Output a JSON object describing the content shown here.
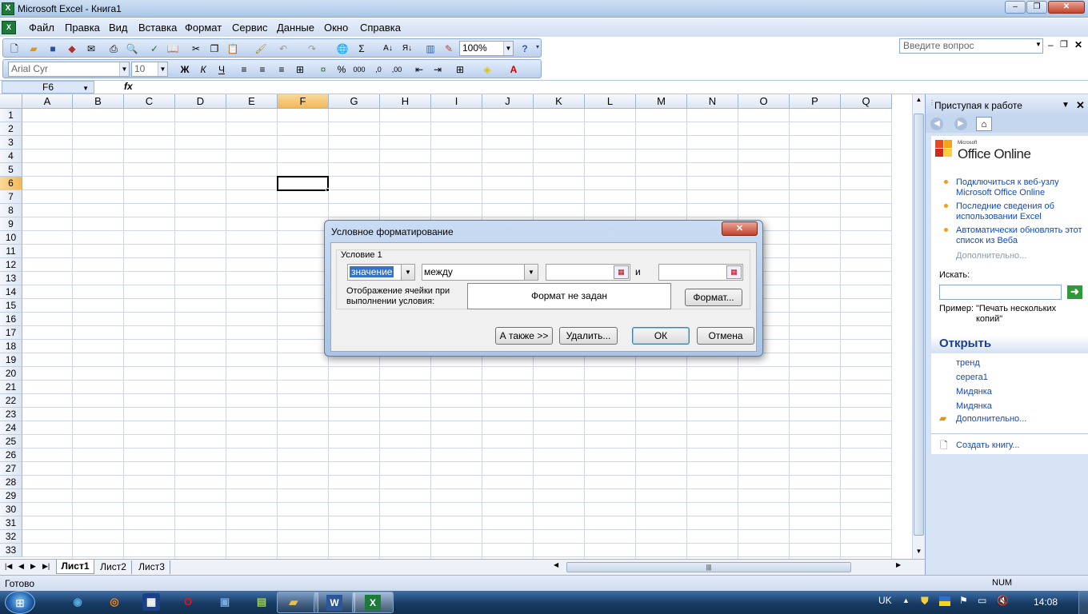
{
  "window": {
    "title": "Microsoft Excel - Книга1"
  },
  "menu": {
    "items": [
      "Файл",
      "Правка",
      "Вид",
      "Вставка",
      "Формат",
      "Сервис",
      "Данные",
      "Окно",
      "Справка"
    ],
    "ask_placeholder": "Введите вопрос"
  },
  "toolbar": {
    "zoom": "100%",
    "font_name": "Arial Cyr",
    "font_size": "10"
  },
  "formula": {
    "cell_ref": "F6",
    "fx": "fx"
  },
  "sheet": {
    "columns": [
      "A",
      "B",
      "C",
      "D",
      "E",
      "F",
      "G",
      "H",
      "I",
      "J",
      "K",
      "L",
      "M",
      "N",
      "O",
      "P",
      "Q"
    ],
    "rows": [
      "1",
      "2",
      "3",
      "4",
      "5",
      "6",
      "7",
      "8",
      "9",
      "10",
      "11",
      "12",
      "13",
      "14",
      "15",
      "16",
      "17",
      "18",
      "19",
      "20",
      "21",
      "22",
      "23",
      "24",
      "25",
      "26",
      "27",
      "28",
      "29",
      "30",
      "31",
      "32",
      "33"
    ],
    "selected_column": "F",
    "selected_row": "6",
    "tabs": [
      "Лист1",
      "Лист2",
      "Лист3"
    ],
    "active_tab": "Лист1"
  },
  "status": {
    "left": "Готово",
    "num": "NUM"
  },
  "taskpane": {
    "title": "Приступая к работе",
    "brand_small": "Microsoft",
    "brand": "Office Online",
    "links": [
      "Подключиться к веб-узлу Microsoft Office Online",
      "Последние сведения об использовании Excel",
      "Автоматически обновлять этот список из Веба"
    ],
    "more": "Дополнительно...",
    "search_label": "Искать:",
    "example_label": "Пример:",
    "example_text": "\"Печать нескольких копий\"",
    "open_title": "Открыть",
    "recent": [
      "тренд",
      "серега1",
      "Мидянка",
      "Мидянка"
    ],
    "open_more": "Дополнительно...",
    "create": "Создать книгу..."
  },
  "dialog": {
    "title": "Условное форматирование",
    "condition_label": "Условие 1",
    "type_value": "значение",
    "op_value": "между",
    "and_label": "и",
    "preview_label": "Отображение ячейки при выполнении условия:",
    "preview_text": "Формат не задан",
    "format_button": "Формат...",
    "also_button": "А также >>",
    "delete_button": "Удалить...",
    "ok_button": "ОК",
    "cancel_button": "Отмена"
  },
  "taskbar": {
    "lang": "UK",
    "time": "14:08"
  }
}
